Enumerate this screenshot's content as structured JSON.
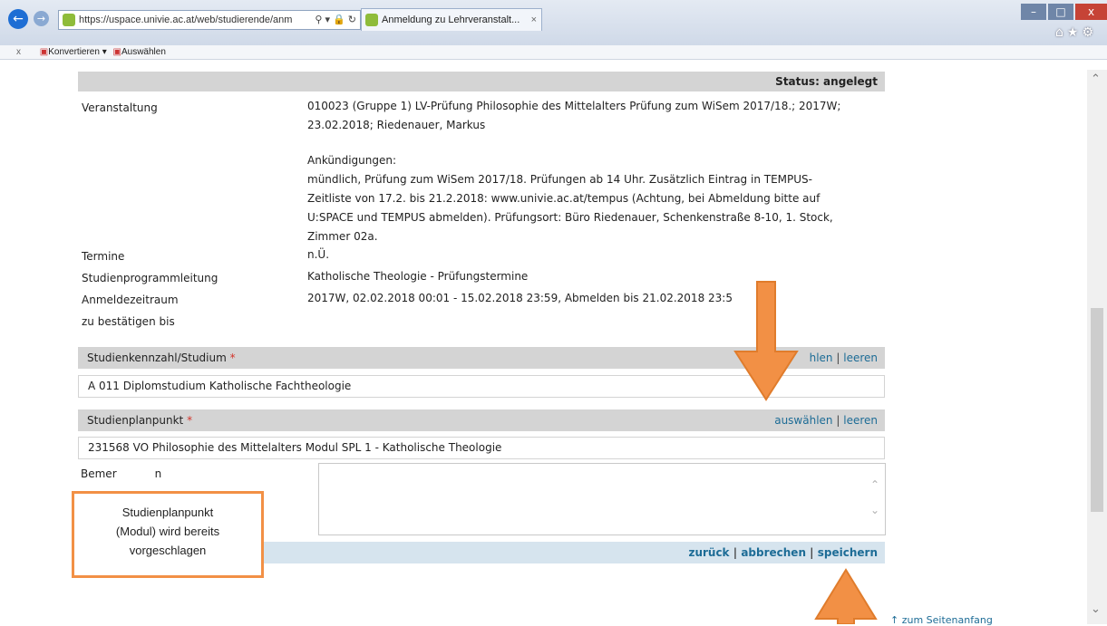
{
  "browser": {
    "url": "https://uspace.univie.ac.at/web/studierende/anm",
    "tab_title": "Anmeldung zu Lehrveranstalt...",
    "tab_close": "×",
    "cmd_close": "x",
    "cmd_convert": "Konvertieren",
    "cmd_select": "Auswählen"
  },
  "status": "Status: angelegt",
  "details": {
    "veranstaltung_label": "Veranstaltung",
    "veranstaltung_line1": "010023 (Gruppe 1) LV-Prüfung Philosophie des Mittelalters Prüfung zum WiSem 2017/18.; 2017W;",
    "veranstaltung_line2": "23.02.2018; Riedenauer, Markus",
    "ankuendigungen_head": "Ankündigungen:",
    "ankuendigungen_l1": "mündlich, Prüfung zum WiSem 2017/18. Prüfungen ab 14 Uhr. Zusätzlich Eintrag in TEMPUS-",
    "ankuendigungen_l2": "Zeitliste von 17.2. bis 21.2.2018: www.univie.ac.at/tempus (Achtung, bei Abmeldung bitte auf",
    "ankuendigungen_l3": "U:SPACE und TEMPUS abmelden). Prüfungsort: Büro Riedenauer, Schenkenstraße 8-10, 1. Stock,",
    "ankuendigungen_l4": "Zimmer 02a.",
    "termine_label": "Termine",
    "termine_value": "n.Ü.",
    "spl_label": "Studienprogrammleitung",
    "spl_value": "Katholische Theologie - Prüfungstermine",
    "anmeldezeitraum_label": "Anmeldezeitraum",
    "anmeldezeitraum_value": "2017W, 02.02.2018 00:01 - 15.02.2018 23:59, Abmelden bis 21.02.2018 23:5",
    "bestaetigen_label": "zu bestätigen bis"
  },
  "studium": {
    "label": "Studienkennzahl/Studium",
    "required_mark": "*",
    "select_link": "hlen",
    "separator": "|",
    "clear_link": "leeren",
    "value": "A 011 Diplomstudium Katholische Fachtheologie"
  },
  "planpunkt": {
    "label": "Studienplanpunkt",
    "required_mark": "*",
    "select_link": "auswählen",
    "separator": "|",
    "clear_link": "leeren",
    "value": "231568 VO Philosophie des Mittelalters Modul SPL 1 - Katholische Theologie"
  },
  "bemerkung_label": "Bemer",
  "bemerkung_label_tail": "n",
  "actions": {
    "back": "zurück",
    "cancel": "abbrechen",
    "save": "speichern",
    "separator": "|"
  },
  "callout": {
    "line1": "Studienplanpunkt",
    "line2": "(Modul) wird bereits",
    "line3": "vorgeschlagen"
  },
  "to_top": "↑ zum Seitenanfang",
  "colors": {
    "annotation_orange": "#f29045",
    "link_blue": "#1d6c96",
    "header_gray": "#d4d4d4"
  }
}
